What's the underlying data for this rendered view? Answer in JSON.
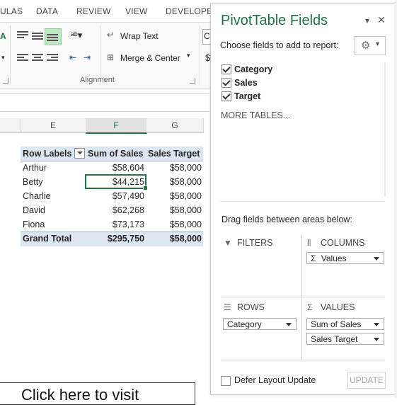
{
  "ribbon": {
    "tabs": [
      "ULAS",
      "DATA",
      "REVIEW",
      "VIEW",
      "DEVELOPER"
    ],
    "wrap_text": "Wrap Text",
    "merge_center": "Merge & Center",
    "group_alignment": "Alignment",
    "font_partial": "Ce",
    "currency_partial": "$"
  },
  "sheet": {
    "columns": [
      "E",
      "F",
      "G"
    ],
    "pivot_headers": [
      "Row Labels",
      "Sum of Sales",
      "Sales Target"
    ],
    "rows": [
      {
        "label": "Arthur",
        "sales": "$58,604",
        "target": "$58,000"
      },
      {
        "label": "Betty",
        "sales": "$44,215",
        "target": "$58,000"
      },
      {
        "label": "Charlie",
        "sales": "$57,490",
        "target": "$58,000"
      },
      {
        "label": "David",
        "sales": "$62,268",
        "target": "$58,000"
      },
      {
        "label": "Fiona",
        "sales": "$73,173",
        "target": "$58,000"
      }
    ],
    "grand_total": {
      "label": "Grand Total",
      "sales": "$295,750",
      "target": "$58,000"
    },
    "visit_text": "Click here to visit"
  },
  "pane": {
    "title": "PivotTable Fields",
    "subtitle": "Choose fields to add to report:",
    "fields": [
      {
        "label": "Category",
        "checked": true
      },
      {
        "label": "Sales",
        "checked": true
      },
      {
        "label": "Target",
        "checked": true
      }
    ],
    "more_tables": "MORE TABLES...",
    "drag_text": "Drag fields between areas below:",
    "filters_label": "FILTERS",
    "columns_label": "COLUMNS",
    "rows_label": "ROWS",
    "values_label": "VALUES",
    "columns_items": [
      "Values"
    ],
    "rows_items": [
      "Category"
    ],
    "values_items": [
      "Sum of Sales",
      "Sales Target"
    ],
    "defer_label": "Defer Layout Update",
    "update_label": "UPDATE",
    "sigma": "Σ",
    "close_glyph": "✕",
    "dropdown_glyph": "▾"
  },
  "colors": {
    "accent": "#217346",
    "pivot_header_bg": "#dce6f1"
  }
}
